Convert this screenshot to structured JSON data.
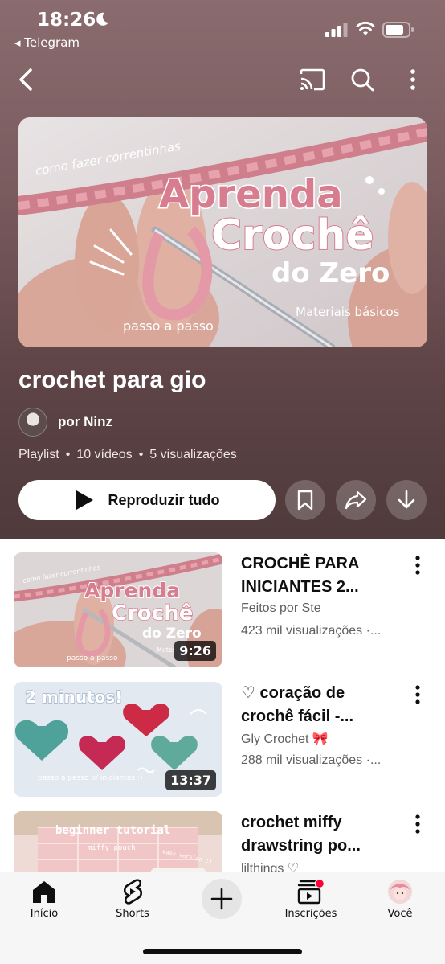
{
  "status_bar": {
    "time": "18:26",
    "back_app": "◂ Telegram"
  },
  "playlist": {
    "title": "crochet para gio",
    "owner": "por Ninz",
    "type": "Playlist",
    "video_count": "10 vídeos",
    "views": "5 visualizações",
    "play_all_label": "Reproduzir tudo",
    "hero_thumbnail": {
      "top_text": "como fazer correntinhas",
      "line1": "Aprenda",
      "line2": "Crochê",
      "line3": "do Zero",
      "bottom_left": "passo a passo",
      "bottom_right": "Materiais básicos"
    }
  },
  "videos": [
    {
      "title": "CROCHÊ PARA INICIANTES 2...",
      "channel": "Feitos por Ste",
      "views": "423 mil visualizações ·...",
      "duration": "9:26",
      "thumb_text": {
        "top": "como fazer correntinhas",
        "l1": "Aprenda",
        "l2": "Crochê",
        "l3": "do Zero",
        "bl": "passo a passo",
        "br": "Materi"
      }
    },
    {
      "title": "♡ coração de crochê fácil  -...",
      "channel": "Gly Crochet 🎀",
      "views": "288 mil visualizações ·...",
      "duration": "13:37",
      "thumb_text": {
        "top": "2 minutos!",
        "bl": "passo a passo p/ iniciantes :)"
      }
    },
    {
      "title": "crochet miffy drawstring po...",
      "channel": "lilthings ♡",
      "views": "",
      "duration": "",
      "thumb_text": {
        "top": "beginner tutorial",
        "mid": "miffy pouch",
        "side": "easy version :)"
      }
    }
  ],
  "bottom_nav": {
    "home": "Início",
    "shorts": "Shorts",
    "subscriptions": "Inscrições",
    "you": "Você"
  },
  "colors": {
    "header_bg": "#6d5255",
    "yarn_pink": "#d98a97",
    "accent_red": "#ff0033"
  }
}
